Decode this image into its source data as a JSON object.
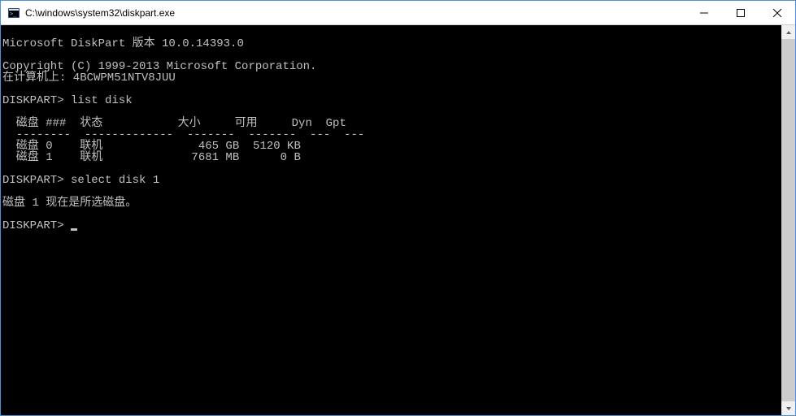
{
  "window": {
    "title": "C:\\windows\\system32\\diskpart.exe"
  },
  "terminal": {
    "line_blank": "",
    "line_version": "Microsoft DiskPart 版本 10.0.14393.0",
    "line_copyright": "Copyright (C) 1999-2013 Microsoft Corporation.",
    "line_computer": "在计算机上: 4BCWPM51NTV8JUU",
    "prompt1": "DISKPART> ",
    "cmd1": "list disk",
    "table_header": "  磁盘 ###  状态           大小     可用     Dyn  Gpt",
    "table_divider": "  --------  -------------  -------  -------  ---  ---",
    "table_row0": "  磁盘 0    联机              465 GB  5120 KB",
    "table_row1": "  磁盘 1    联机             7681 MB      0 B",
    "prompt2": "DISKPART> ",
    "cmd2": "select disk 1",
    "line_selected": "磁盘 1 现在是所选磁盘。",
    "prompt3": "DISKPART> "
  },
  "icons": {
    "app": "diskpart-icon",
    "minimize": "minimize-icon",
    "maximize": "maximize-icon",
    "close": "close-icon",
    "scroll_up": "scroll-up-icon",
    "scroll_down": "scroll-down-icon"
  }
}
